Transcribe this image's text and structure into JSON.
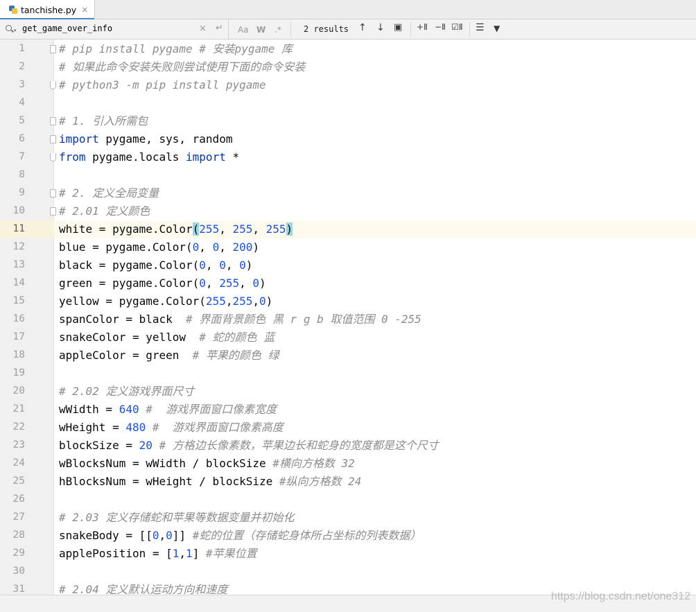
{
  "tab": {
    "filename": "tanchishe.py",
    "close": "×"
  },
  "find": {
    "query": "get_game_over_info",
    "clear": "×",
    "enter": "↵",
    "match_case": "Aa",
    "words": "W",
    "regex": ".*",
    "results": "2 results",
    "prev": "↑",
    "next": "↓",
    "select_all": "▣",
    "add_occurrence": "+Ⅱ",
    "remove_occurrence": "−Ⅱ",
    "exclude_occurrence": "☑Ⅱ",
    "filter_options": "☰",
    "filter": "▼"
  },
  "editor": {
    "current_line": 11,
    "lines": [
      "# pip install pygame # 安装pygame 库",
      "# 如果此命令安装失败则尝试使用下面的命令安装",
      "# python3 -m pip install pygame",
      "",
      "# 1. 引入所需包",
      "import pygame, sys, random",
      "from pygame.locals import *",
      "",
      "# 2. 定义全局变量",
      "# 2.01 定义颜色",
      "white = pygame.Color(255, 255, 255)",
      "blue = pygame.Color(0, 0, 200)",
      "black = pygame.Color(0, 0, 0)",
      "green = pygame.Color(0, 255, 0)",
      "yellow = pygame.Color(255,255,0)",
      "spanColor = black  # 界面背景颜色 黑 r g b 取值范围 0 -255",
      "snakeColor = yellow  # 蛇的颜色 蓝",
      "appleColor = green  # 苹果的颜色 绿",
      "",
      "# 2.02 定义游戏界面尺寸",
      "wWidth = 640 #  游戏界面窗口像素宽度",
      "wHeight = 480 #  游戏界面窗口像素高度",
      "blockSize = 20 # 方格边长像素数，苹果边长和蛇身的宽度都是这个尺寸",
      "wBlocksNum = wWidth / blockSize #横向方格数 32",
      "hBlocksNum = wHeight / blockSize #纵向方格数 24",
      "",
      "# 2.03 定义存储蛇和苹果等数据变量并初始化",
      "snakeBody = [[0,0]] #蛇的位置（存储蛇身体所占坐标的列表数据）",
      "applePosition = [1,1] #苹果位置",
      "",
      "# 2.04 定义默认运动方向和速度"
    ]
  },
  "watermark": "https://blog.csdn.net/one312"
}
